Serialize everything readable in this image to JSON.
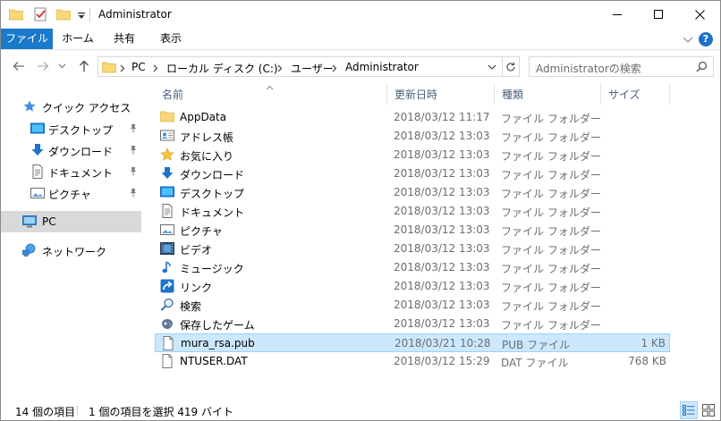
{
  "window": {
    "title": "Administrator",
    "buttons": {
      "minimize": "minimize",
      "maximize": "maximize",
      "close": "close"
    }
  },
  "ribbon": {
    "tabs": [
      "ファイル",
      "ホーム",
      "共有",
      "表示"
    ]
  },
  "address": {
    "crumbs": [
      "PC",
      "ローカル ディスク (C:)",
      "ユーザー",
      "Administrator"
    ]
  },
  "search": {
    "placeholder": "Administratorの検索"
  },
  "navpane": {
    "quick_access": "クイック アクセス",
    "quick_items": [
      "デスクトップ",
      "ダウンロード",
      "ドキュメント",
      "ピクチャ"
    ],
    "pc": "PC",
    "network": "ネットワーク"
  },
  "columns": {
    "name": "名前",
    "date": "更新日時",
    "type": "種類",
    "size": "サイズ"
  },
  "files": [
    {
      "name": "AppData",
      "date": "2018/03/12 11:17",
      "type": "ファイル フォルダー",
      "size": "",
      "icon": "folder-icon"
    },
    {
      "name": "アドレス帳",
      "date": "2018/03/12 13:03",
      "type": "ファイル フォルダー",
      "size": "",
      "icon": "contacts-icon"
    },
    {
      "name": "お気に入り",
      "date": "2018/03/12 13:03",
      "type": "ファイル フォルダー",
      "size": "",
      "icon": "favorites-star-icon"
    },
    {
      "name": "ダウンロード",
      "date": "2018/03/12 13:03",
      "type": "ファイル フォルダー",
      "size": "",
      "icon": "downloads-arrow-icon"
    },
    {
      "name": "デスクトップ",
      "date": "2018/03/12 13:03",
      "type": "ファイル フォルダー",
      "size": "",
      "icon": "desktop-icon"
    },
    {
      "name": "ドキュメント",
      "date": "2018/03/12 13:03",
      "type": "ファイル フォルダー",
      "size": "",
      "icon": "documents-icon"
    },
    {
      "name": "ピクチャ",
      "date": "2018/03/12 13:03",
      "type": "ファイル フォルダー",
      "size": "",
      "icon": "pictures-icon"
    },
    {
      "name": "ビデオ",
      "date": "2018/03/12 13:03",
      "type": "ファイル フォルダー",
      "size": "",
      "icon": "videos-icon"
    },
    {
      "name": "ミュージック",
      "date": "2018/03/12 13:03",
      "type": "ファイル フォルダー",
      "size": "",
      "icon": "music-note-icon"
    },
    {
      "name": "リンク",
      "date": "2018/03/12 13:03",
      "type": "ファイル フォルダー",
      "size": "",
      "icon": "links-icon"
    },
    {
      "name": "検索",
      "date": "2018/03/12 13:03",
      "type": "ファイル フォルダー",
      "size": "",
      "icon": "searches-icon"
    },
    {
      "name": "保存したゲーム",
      "date": "2018/03/12 13:03",
      "type": "ファイル フォルダー",
      "size": "",
      "icon": "saved-games-icon"
    },
    {
      "name": "mura_rsa.pub",
      "date": "2018/03/21 10:28",
      "type": "PUB ファイル",
      "size": "1 KB",
      "icon": "file-icon",
      "selected": true
    },
    {
      "name": "NTUSER.DAT",
      "date": "2018/03/12 15:29",
      "type": "DAT ファイル",
      "size": "768 KB",
      "icon": "file-icon"
    }
  ],
  "status": {
    "item_count": "14 個の項目",
    "selection": "1 個の項目を選択  419 バイト"
  },
  "colors": {
    "accent": "#1979ca",
    "selection_bg": "#cce8ff",
    "selection_border": "#99d1ff",
    "folder_yellow": "#f8d775"
  }
}
